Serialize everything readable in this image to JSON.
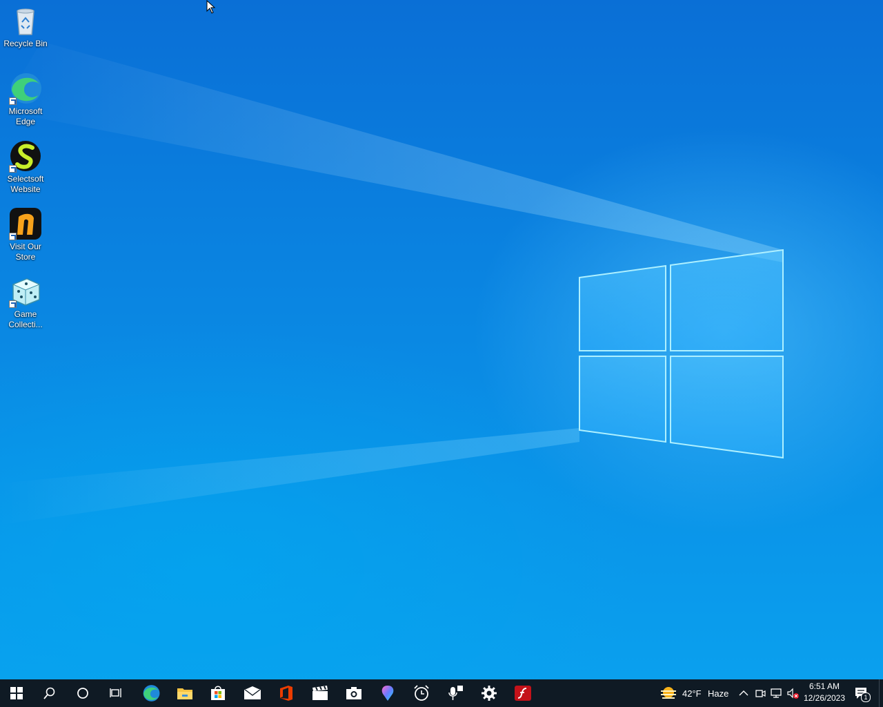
{
  "desktop": {
    "icons": [
      {
        "label1": "Recycle Bin",
        "label2": "",
        "icon": "recycle-bin-icon"
      },
      {
        "label1": "Microsoft",
        "label2": "Edge",
        "icon": "edge-icon"
      },
      {
        "label1": "Selectsoft",
        "label2": "Website",
        "icon": "selectsoft-icon"
      },
      {
        "label1": "Visit Our",
        "label2": "Store",
        "icon": "store-logo-icon"
      },
      {
        "label1": "Game",
        "label2": "Collecti...",
        "icon": "game-dice-icon"
      }
    ],
    "wallpaper_color": "#0a86e0"
  },
  "taskbar": {
    "background": "#0f1a24",
    "pinned": [
      "start-icon",
      "search-icon",
      "cortana-icon",
      "task-view-icon",
      "edge-icon",
      "file-explorer-icon",
      "store-icon",
      "mail-icon",
      "office-icon",
      "movies-icon",
      "camera-icon",
      "paint3d-icon",
      "alarms-icon",
      "voice-recorder-icon",
      "settings-icon",
      "flash-icon"
    ],
    "weather": {
      "temp": "42°F",
      "condition": "Haze"
    },
    "clock": {
      "time": "6:51 AM",
      "date": "12/26/2023"
    },
    "notifications": {
      "count": "1"
    }
  }
}
